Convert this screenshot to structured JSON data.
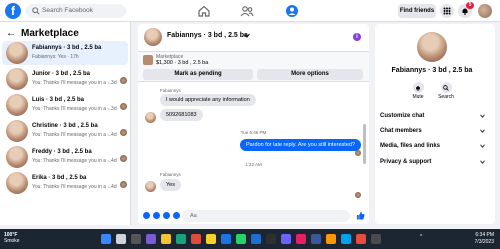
{
  "topbar": {
    "logo": "f",
    "search_placeholder": "Search Facebook",
    "find_friends": "Find friends",
    "notification_count": "5"
  },
  "marketplace": {
    "title": "Marketplace",
    "back_arrow": "←",
    "conversations": [
      {
        "name": "Fabiannys · 3 bd , 2.5 ba",
        "snippet": "Fabiannys: Yes · 17h",
        "time": "",
        "active": true
      },
      {
        "name": "Junior · 3 bd , 2.5 ba",
        "snippet": "You: Thanks I'll message you in a ...",
        "time": "· 3d"
      },
      {
        "name": "Luis · 3 bd , 2.5 ba",
        "snippet": "You: Thanks I'll message you in a ...",
        "time": "· 3d"
      },
      {
        "name": "Christine · 3 bd , 2.5 ba",
        "snippet": "You: Thanks I'll message you in a ...",
        "time": "· 4d"
      },
      {
        "name": "Freddy · 3 bd , 2.5 ba",
        "snippet": "You: Thanks I'll message you in a ...",
        "time": "· 4d"
      },
      {
        "name": "Erika · 3 bd , 2.5 ba",
        "snippet": "You: Thanks I'll message you in a ...",
        "time": "· 4d"
      }
    ]
  },
  "chat": {
    "title": "Fabiannys · 3 bd , 2.5 ba",
    "info": "i",
    "listing_label": "Marketplace",
    "listing_price": "$1,300 · 3 bd , 2.5 ba",
    "mark_pending": "Mark as pending",
    "more_options": "More options",
    "messages": {
      "sender1": "Fabiannys",
      "msg1": "I would appreciate any information",
      "msg2": "5092681083",
      "ts1": "Tue 6:46 PM",
      "out1": "Pardon for late reply. Are you still interested?",
      "ts2": "1:22 AM",
      "sender2": "Fabiannys",
      "msg3": "Yes"
    },
    "composer_placeholder": "Aa"
  },
  "profile": {
    "name": "Fabiannys · 3 bd , 2.5 ba",
    "mute": "Mute",
    "search": "Search",
    "rows": [
      "Customize chat",
      "Chat members",
      "Media, files and links",
      "Privacy & support"
    ]
  },
  "taskbar": {
    "temp": "100°F",
    "condition": "Smoke",
    "tray_label": "^",
    "time": "6:34 PM",
    "date": "7/3/2023"
  }
}
